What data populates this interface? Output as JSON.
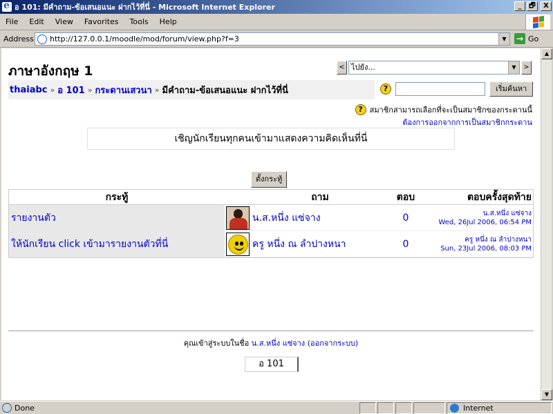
{
  "window": {
    "title": "อ 101: มีคำถาม-ข้อเสนอแนะ ฝากไว้ที่นี่ - Microsoft Internet Explorer",
    "minimize": "_",
    "maximize": "🗗",
    "close": "X"
  },
  "menu": [
    "File",
    "Edit",
    "View",
    "Favorites",
    "Tools",
    "Help"
  ],
  "address": {
    "label": "Address",
    "url": "http://127.0.0.1/moodle/mod/forum/view.php?f=3",
    "go": "Go"
  },
  "course": {
    "title": "ภาษาอังกฤษ 1"
  },
  "jump": {
    "prev": "<",
    "next": ">",
    "selected": "ไปยัง..."
  },
  "breadcrumb": {
    "site": "thaiabc",
    "course": "อ 101",
    "forums": "กระดานเสวนา",
    "current": "มีคำถาม-ข้อเสนอแนะ ฝากไว้ที่นี่",
    "separator": "»"
  },
  "search": {
    "help": "?",
    "value": "",
    "button": "เริ่มค้นหา"
  },
  "subscription": {
    "info": "สมาชิกสามารถเลือกที่จะเป็นสมาชิกของกระดานนี้",
    "link": "ต้องการออกจากการเป็นสมาชิกกระดาน"
  },
  "intro": "เชิญนักเรียนทุกคนเข้ามาแสดงความคิดเห็นที่นี่",
  "add_discussion": "ตั้งกระทู้",
  "table": {
    "headers": {
      "topic": "กระทู้",
      "author": "ถาม",
      "replies": "ตอบ",
      "last": "ตอบครั้งสุดท้าย"
    },
    "rows": [
      {
        "topic": "รายงานตัว",
        "author": "น.ส.หนึ่ง แซ่จาง",
        "replies": "0",
        "last_name": "น.ส.หนึ่ง แซ่จาง",
        "last_date": "Wed, 26Jul 2006, 06:54 PM"
      },
      {
        "topic": "ให้นักเรียน click เข้ามารายงานตัวที่นี่",
        "author": "ครู หนึ่ง ณ ลำปางหนา",
        "replies": "0",
        "last_name": "ครู หนึ่ง ณ ลำปางหนา",
        "last_date": "Sun, 23Jul 2006, 08:03 PM"
      }
    ]
  },
  "footer": {
    "login_prefix": "คุณเข้าสู่ระบบในชื่อ",
    "user": "น.ส.หนึ่ง แซ่จาง",
    "logout": "(ออกจากระบบ)",
    "home": "อ 101"
  },
  "status": {
    "text": "Done",
    "zone": "Internet"
  },
  "colors": {
    "link": "#0000cc",
    "titlebar": "#0a246a"
  }
}
